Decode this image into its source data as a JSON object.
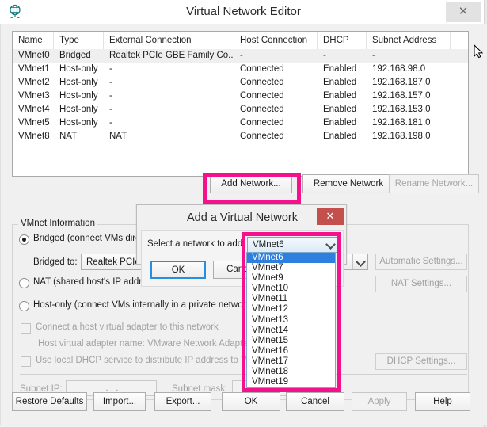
{
  "window": {
    "title": "Virtual Network Editor",
    "icon": "network-globe-icon",
    "close_label": "✕"
  },
  "network_table": {
    "columns": [
      "Name",
      "Type",
      "External Connection",
      "Host Connection",
      "DHCP",
      "Subnet Address"
    ],
    "rows": [
      {
        "name": "VMnet0",
        "type": "Bridged",
        "external": "Realtek PCIe GBE Family Co...",
        "host": "-",
        "dhcp": "-",
        "subnet": "-",
        "selected": true
      },
      {
        "name": "VMnet1",
        "type": "Host-only",
        "external": "-",
        "host": "Connected",
        "dhcp": "Enabled",
        "subnet": "192.168.98.0",
        "selected": false
      },
      {
        "name": "VMnet2",
        "type": "Host-only",
        "external": "-",
        "host": "Connected",
        "dhcp": "Enabled",
        "subnet": "192.168.187.0",
        "selected": false
      },
      {
        "name": "VMnet3",
        "type": "Host-only",
        "external": "-",
        "host": "Connected",
        "dhcp": "Enabled",
        "subnet": "192.168.157.0",
        "selected": false
      },
      {
        "name": "VMnet4",
        "type": "Host-only",
        "external": "-",
        "host": "Connected",
        "dhcp": "Enabled",
        "subnet": "192.168.153.0",
        "selected": false
      },
      {
        "name": "VMnet5",
        "type": "Host-only",
        "external": "-",
        "host": "Connected",
        "dhcp": "Enabled",
        "subnet": "192.168.181.0",
        "selected": false
      },
      {
        "name": "VMnet8",
        "type": "NAT",
        "external": "NAT",
        "host": "Connected",
        "dhcp": "Enabled",
        "subnet": "192.168.198.0",
        "selected": false
      }
    ]
  },
  "network_actions": {
    "add_network": "Add Network...",
    "remove_network": "Remove Network",
    "rename_network": "Rename Network..."
  },
  "vmnet_info": {
    "group_title": "VMnet Information",
    "bridged_radio": "Bridged (connect VMs directly to the external network)",
    "bridged_to_label": "Bridged to:",
    "bridged_to_value": "Realtek PCIe GBE Family Controller",
    "automatic_settings": "Automatic Settings...",
    "nat_radio": "NAT (shared host's IP address with VMs)",
    "nat_settings": "NAT Settings...",
    "hostonly_radio": "Host-only (connect VMs internally in a private network)",
    "connect_adapter_checkbox": "Connect a host virtual adapter to this network",
    "adapter_name_label": "Host virtual adapter name: VMware Network Adapter VMnet0",
    "local_dhcp_checkbox": "Use local DHCP service to distribute IP address to VMs",
    "dhcp_settings": "DHCP Settings...",
    "subnet_ip_label": "Subnet IP:",
    "subnet_ip_value": ".     .     .",
    "subnet_mask_label": "Subnet mask:",
    "subnet_mask_value": ""
  },
  "footer": {
    "restore_defaults": "Restore Defaults",
    "import": "Import...",
    "export": "Export...",
    "ok": "OK",
    "cancel": "Cancel",
    "apply": "Apply",
    "help": "Help"
  },
  "add_dialog": {
    "title": "Add a Virtual Network",
    "close_label": "✕",
    "select_label": "Select a network to add:",
    "selected_network": "VMnet6",
    "ok": "OK",
    "cancel": "Cancel",
    "options": [
      "VMnet6",
      "VMnet7",
      "VMnet9",
      "VMnet10",
      "VMnet11",
      "VMnet12",
      "VMnet13",
      "VMnet14",
      "VMnet15",
      "VMnet16",
      "VMnet17",
      "VMnet18",
      "VMnet19"
    ]
  },
  "annotations": {
    "highlight_color": "#f5108c",
    "boxes": [
      "add-network-button",
      "network-select-dropdown"
    ]
  }
}
